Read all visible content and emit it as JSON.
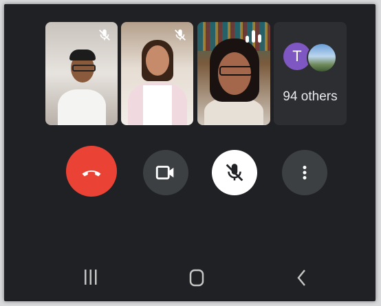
{
  "call": {
    "participants": [
      {
        "tile": "participant-1",
        "muted": true
      },
      {
        "tile": "participant-2",
        "muted": true
      },
      {
        "tile": "participant-3",
        "speaking": true
      }
    ],
    "overflow": {
      "avatar_initial": "T",
      "others_label": "94 others"
    }
  },
  "controls": {
    "end_call": "end-call-icon",
    "camera": "video-camera-icon",
    "microphone": "mic-off-icon",
    "more": "more-vert-icon"
  },
  "nav_bar": {
    "recent": "recent-apps-icon",
    "home": "home-icon",
    "back": "back-icon"
  },
  "colors": {
    "background": "#202124",
    "tile_dark": "#2d2e31",
    "end_call_red": "#ea4335",
    "control_gray": "#3c4043",
    "mic_active_white": "#ffffff",
    "avatar_purple": "#7e57c2",
    "nav_gray": "#c4c7c5"
  }
}
